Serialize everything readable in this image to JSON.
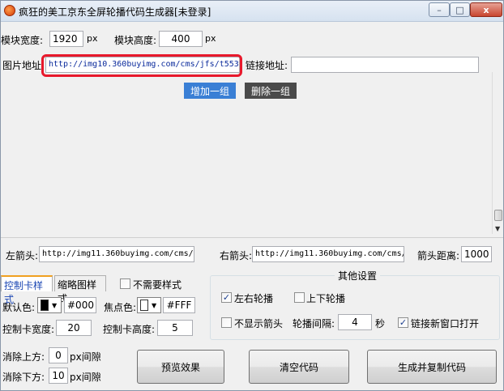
{
  "window": {
    "title": "疯狂的美工京东全屏轮播代码生成器[未登录]",
    "controls": {
      "minimize": "–",
      "maximize": "□",
      "close": "x"
    }
  },
  "module": {
    "width_label": "模块宽度:",
    "width_value": "1920",
    "width_unit": "px",
    "height_label": "模块高度:",
    "height_value": "400",
    "height_unit": "px"
  },
  "image_row": {
    "image_label": "图片地址:",
    "image_value": "http://img10.360buyimg.com/cms/jfs/t553/1",
    "link_label": "链接地址:",
    "link_value": ""
  },
  "group_buttons": {
    "add": "增加一组",
    "delete": "删除一组",
    "add_color": "#3a7fd5",
    "delete_color": "#4a4a4a"
  },
  "arrows": {
    "left_label": "左箭头:",
    "left_value": "http://img11.360buyimg.com/cms/jf",
    "right_label": "右箭头:",
    "right_value": "http://img11.360buyimg.com/cms/j:",
    "distance_label": "箭头距离:",
    "distance_value": "1000"
  },
  "tabs": {
    "control_style": "控制卡样式",
    "thumb_style": "缩略图样式",
    "no_style_label": "不需要样式"
  },
  "control_card": {
    "default_color_label": "默认色:",
    "default_color_value": "#000",
    "default_swatch": "#000000",
    "focus_color_label": "焦点色:",
    "focus_color_value": "#FFF",
    "focus_swatch": "#ffffff",
    "width_label": "控制卡宽度:",
    "width_value": "20",
    "height_label": "控制卡高度:",
    "height_value": "5"
  },
  "other_settings": {
    "title": "其他设置",
    "lr_label": "左右轮播",
    "lr_checked": "✓",
    "ud_label": "上下轮播",
    "no_arrow_label": "不显示箭头",
    "interval_label": "轮播间隔:",
    "interval_value": "4",
    "interval_unit": "秒",
    "new_window_label": "链接新窗口打开",
    "new_window_checked": "✓"
  },
  "gaps": {
    "top_label": "消除上方:",
    "top_value": "0",
    "top_unit": "px间隙",
    "bottom_label": "消除下方:",
    "bottom_value": "10",
    "bottom_unit": "px间隙"
  },
  "actions": {
    "preview": "预览效果",
    "clear": "清空代码",
    "generate": "生成并复制代码"
  }
}
